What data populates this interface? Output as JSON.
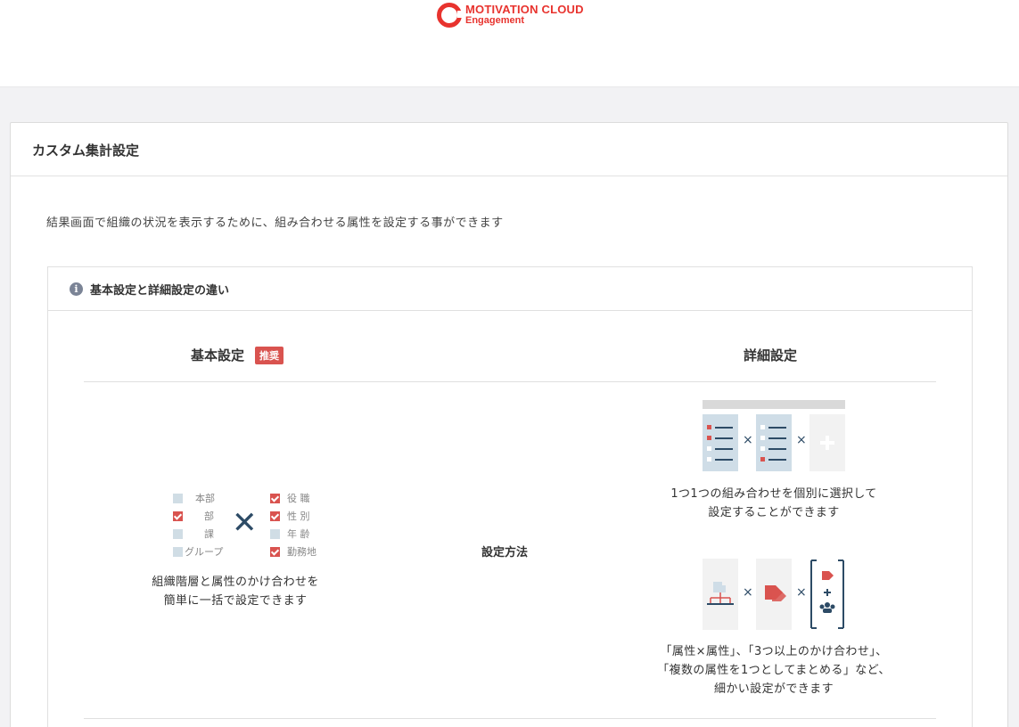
{
  "app": {
    "logo_main": "MOTIVATION CLOUD",
    "logo_sub": "Engagement"
  },
  "card": {
    "title": "カスタム集計設定",
    "description": "結果画面で組織の状況を表示するために、組み合わせる属性を設定する事ができます"
  },
  "info": {
    "title": "基本設定と詳細設定の違い",
    "basic": {
      "heading": "基本設定",
      "badge": "推奨",
      "left_items": [
        {
          "label": "本部",
          "checked": false
        },
        {
          "label": "部",
          "checked": true
        },
        {
          "label": "課",
          "checked": false
        },
        {
          "label": "グループ",
          "checked": false
        }
      ],
      "right_items": [
        {
          "label": "役 職",
          "checked": true
        },
        {
          "label": "性 別",
          "checked": true
        },
        {
          "label": "年 齢",
          "checked": false
        },
        {
          "label": "勤務地",
          "checked": true
        }
      ],
      "caption_line1": "組織階層と属性のかけ合わせを",
      "caption_line2": "簡単に一括で設定できます"
    },
    "method_label": "設定方法",
    "advanced": {
      "heading": "詳細設定",
      "caption1_line1": "1つ1つの組み合わせを個別に選択して",
      "caption1_line2": "設定することができます",
      "caption2_line1": "「属性×属性」、「3つ以上のかけ合わせ」、",
      "caption2_line2": "「複数の属性を1つとしてまとめる」など、",
      "caption2_line3": "細かい設定ができます"
    }
  },
  "colors": {
    "accent": "#e8332e",
    "badge": "#d9534f",
    "navy": "#2d4b66"
  }
}
